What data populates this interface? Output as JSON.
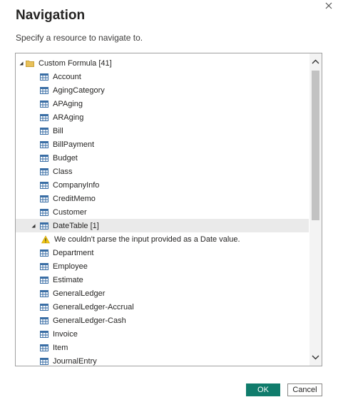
{
  "dialog": {
    "title": "Navigation",
    "subtitle": "Specify a resource to navigate to.",
    "ok_label": "OK",
    "cancel_label": "Cancel"
  },
  "tree": {
    "root": {
      "label": "Custom Formula [41]",
      "icon": "folder-icon",
      "expanded": true
    },
    "items": [
      {
        "label": "Account",
        "icon": "table-icon"
      },
      {
        "label": "AgingCategory",
        "icon": "table-icon"
      },
      {
        "label": "APAging",
        "icon": "table-icon"
      },
      {
        "label": "ARAging",
        "icon": "table-icon"
      },
      {
        "label": "Bill",
        "icon": "table-icon"
      },
      {
        "label": "BillPayment",
        "icon": "table-icon"
      },
      {
        "label": "Budget",
        "icon": "table-icon"
      },
      {
        "label": "Class",
        "icon": "table-icon"
      },
      {
        "label": "CompanyInfo",
        "icon": "table-icon"
      },
      {
        "label": "CreditMemo",
        "icon": "table-icon"
      },
      {
        "label": "Customer",
        "icon": "table-icon"
      },
      {
        "label": "DateTable [1]",
        "icon": "table-icon",
        "expanded": true,
        "selected": true,
        "children": [
          {
            "label": "We couldn't parse the input provided as a Date value.",
            "icon": "warning-icon"
          }
        ]
      },
      {
        "label": "Department",
        "icon": "table-icon"
      },
      {
        "label": "Employee",
        "icon": "table-icon"
      },
      {
        "label": "Estimate",
        "icon": "table-icon"
      },
      {
        "label": "GeneralLedger",
        "icon": "table-icon"
      },
      {
        "label": "GeneralLedger-Accrual",
        "icon": "table-icon"
      },
      {
        "label": "GeneralLedger-Cash",
        "icon": "table-icon"
      },
      {
        "label": "Invoice",
        "icon": "table-icon"
      },
      {
        "label": "Item",
        "icon": "table-icon"
      },
      {
        "label": "JournalEntry",
        "icon": "table-icon"
      }
    ]
  },
  "colors": {
    "accent": "#107c6c",
    "selected_row": "#eaeaea",
    "scroll_thumb": "#c2c2c2",
    "folder": "#e8c15a",
    "table_icon": "#3a6ea5",
    "warning": "#f2c811"
  }
}
